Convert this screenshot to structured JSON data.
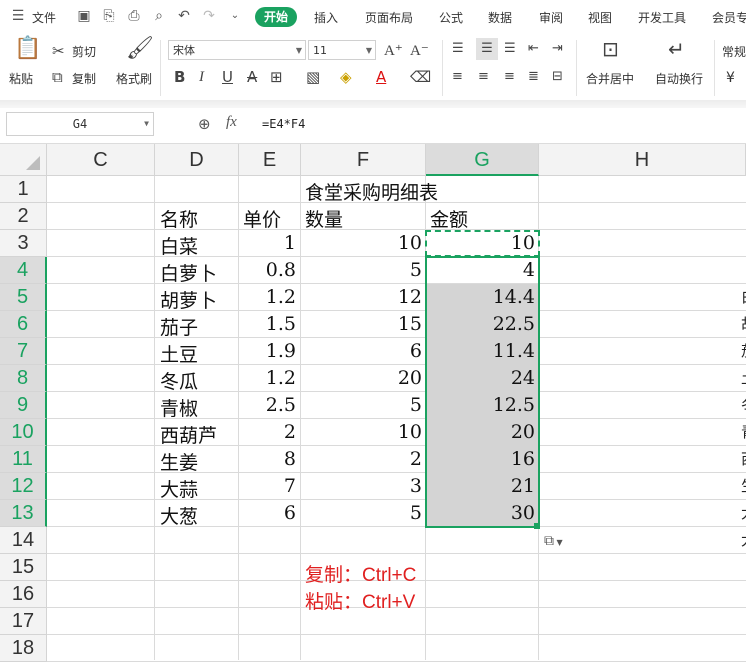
{
  "menubar": {
    "file_label": "文件",
    "tabs": [
      "开始",
      "插入",
      "页面布局",
      "公式",
      "数据",
      "审阅",
      "视图",
      "开发工具",
      "会员专"
    ]
  },
  "ribbon": {
    "paste": "粘贴",
    "cut": "剪切",
    "copy": "复制",
    "format_painter": "格式刷",
    "font_name": "宋体",
    "font_size": "11",
    "merge_center": "合并居中",
    "wrap_text": "自动换行",
    "number_format": "常规",
    "currency_symbol": "¥"
  },
  "formula_bar": {
    "name_box": "G4",
    "fx": "fx",
    "formula": "=E4*F4"
  },
  "sheet": {
    "columns": [
      "C",
      "D",
      "E",
      "F",
      "G",
      "H"
    ],
    "rows": [
      "1",
      "2",
      "3",
      "4",
      "5",
      "6",
      "7",
      "8",
      "9",
      "10",
      "11",
      "12",
      "13",
      "14",
      "15",
      "16",
      "17",
      "18"
    ],
    "title": "食堂采购明细表",
    "headers": {
      "name": "名称",
      "price": "单价",
      "qty": "数量",
      "amount": "金额"
    },
    "data": [
      {
        "name": "白菜",
        "price": "1",
        "qty": "10",
        "amount": "10"
      },
      {
        "name": "白萝卜",
        "price": "0.8",
        "qty": "5",
        "amount": "4"
      },
      {
        "name": "胡萝卜",
        "price": "1.2",
        "qty": "12",
        "amount": "14.4"
      },
      {
        "name": "茄子",
        "price": "1.5",
        "qty": "15",
        "amount": "22.5"
      },
      {
        "name": "土豆",
        "price": "1.9",
        "qty": "6",
        "amount": "11.4"
      },
      {
        "name": "冬瓜",
        "price": "1.2",
        "qty": "20",
        "amount": "24"
      },
      {
        "name": "青椒",
        "price": "2.5",
        "qty": "5",
        "amount": "12.5"
      },
      {
        "name": "西葫芦",
        "price": "2",
        "qty": "10",
        "amount": "20"
      },
      {
        "name": "生姜",
        "price": "8",
        "qty": "2",
        "amount": "16"
      },
      {
        "name": "大蒜",
        "price": "7",
        "qty": "3",
        "amount": "21"
      },
      {
        "name": "大葱",
        "price": "6",
        "qty": "5",
        "amount": "30"
      }
    ],
    "right_edge_chars": [
      "白",
      "胡",
      "茄",
      "土",
      "冬",
      "青",
      "西",
      "生",
      "大",
      "大"
    ]
  },
  "notes": {
    "copy": "复制：Ctrl+C",
    "paste": "粘贴：Ctrl+V"
  },
  "colors": {
    "accent": "#1aa260",
    "selection": "#d4d4d4",
    "note": "#e02020"
  }
}
